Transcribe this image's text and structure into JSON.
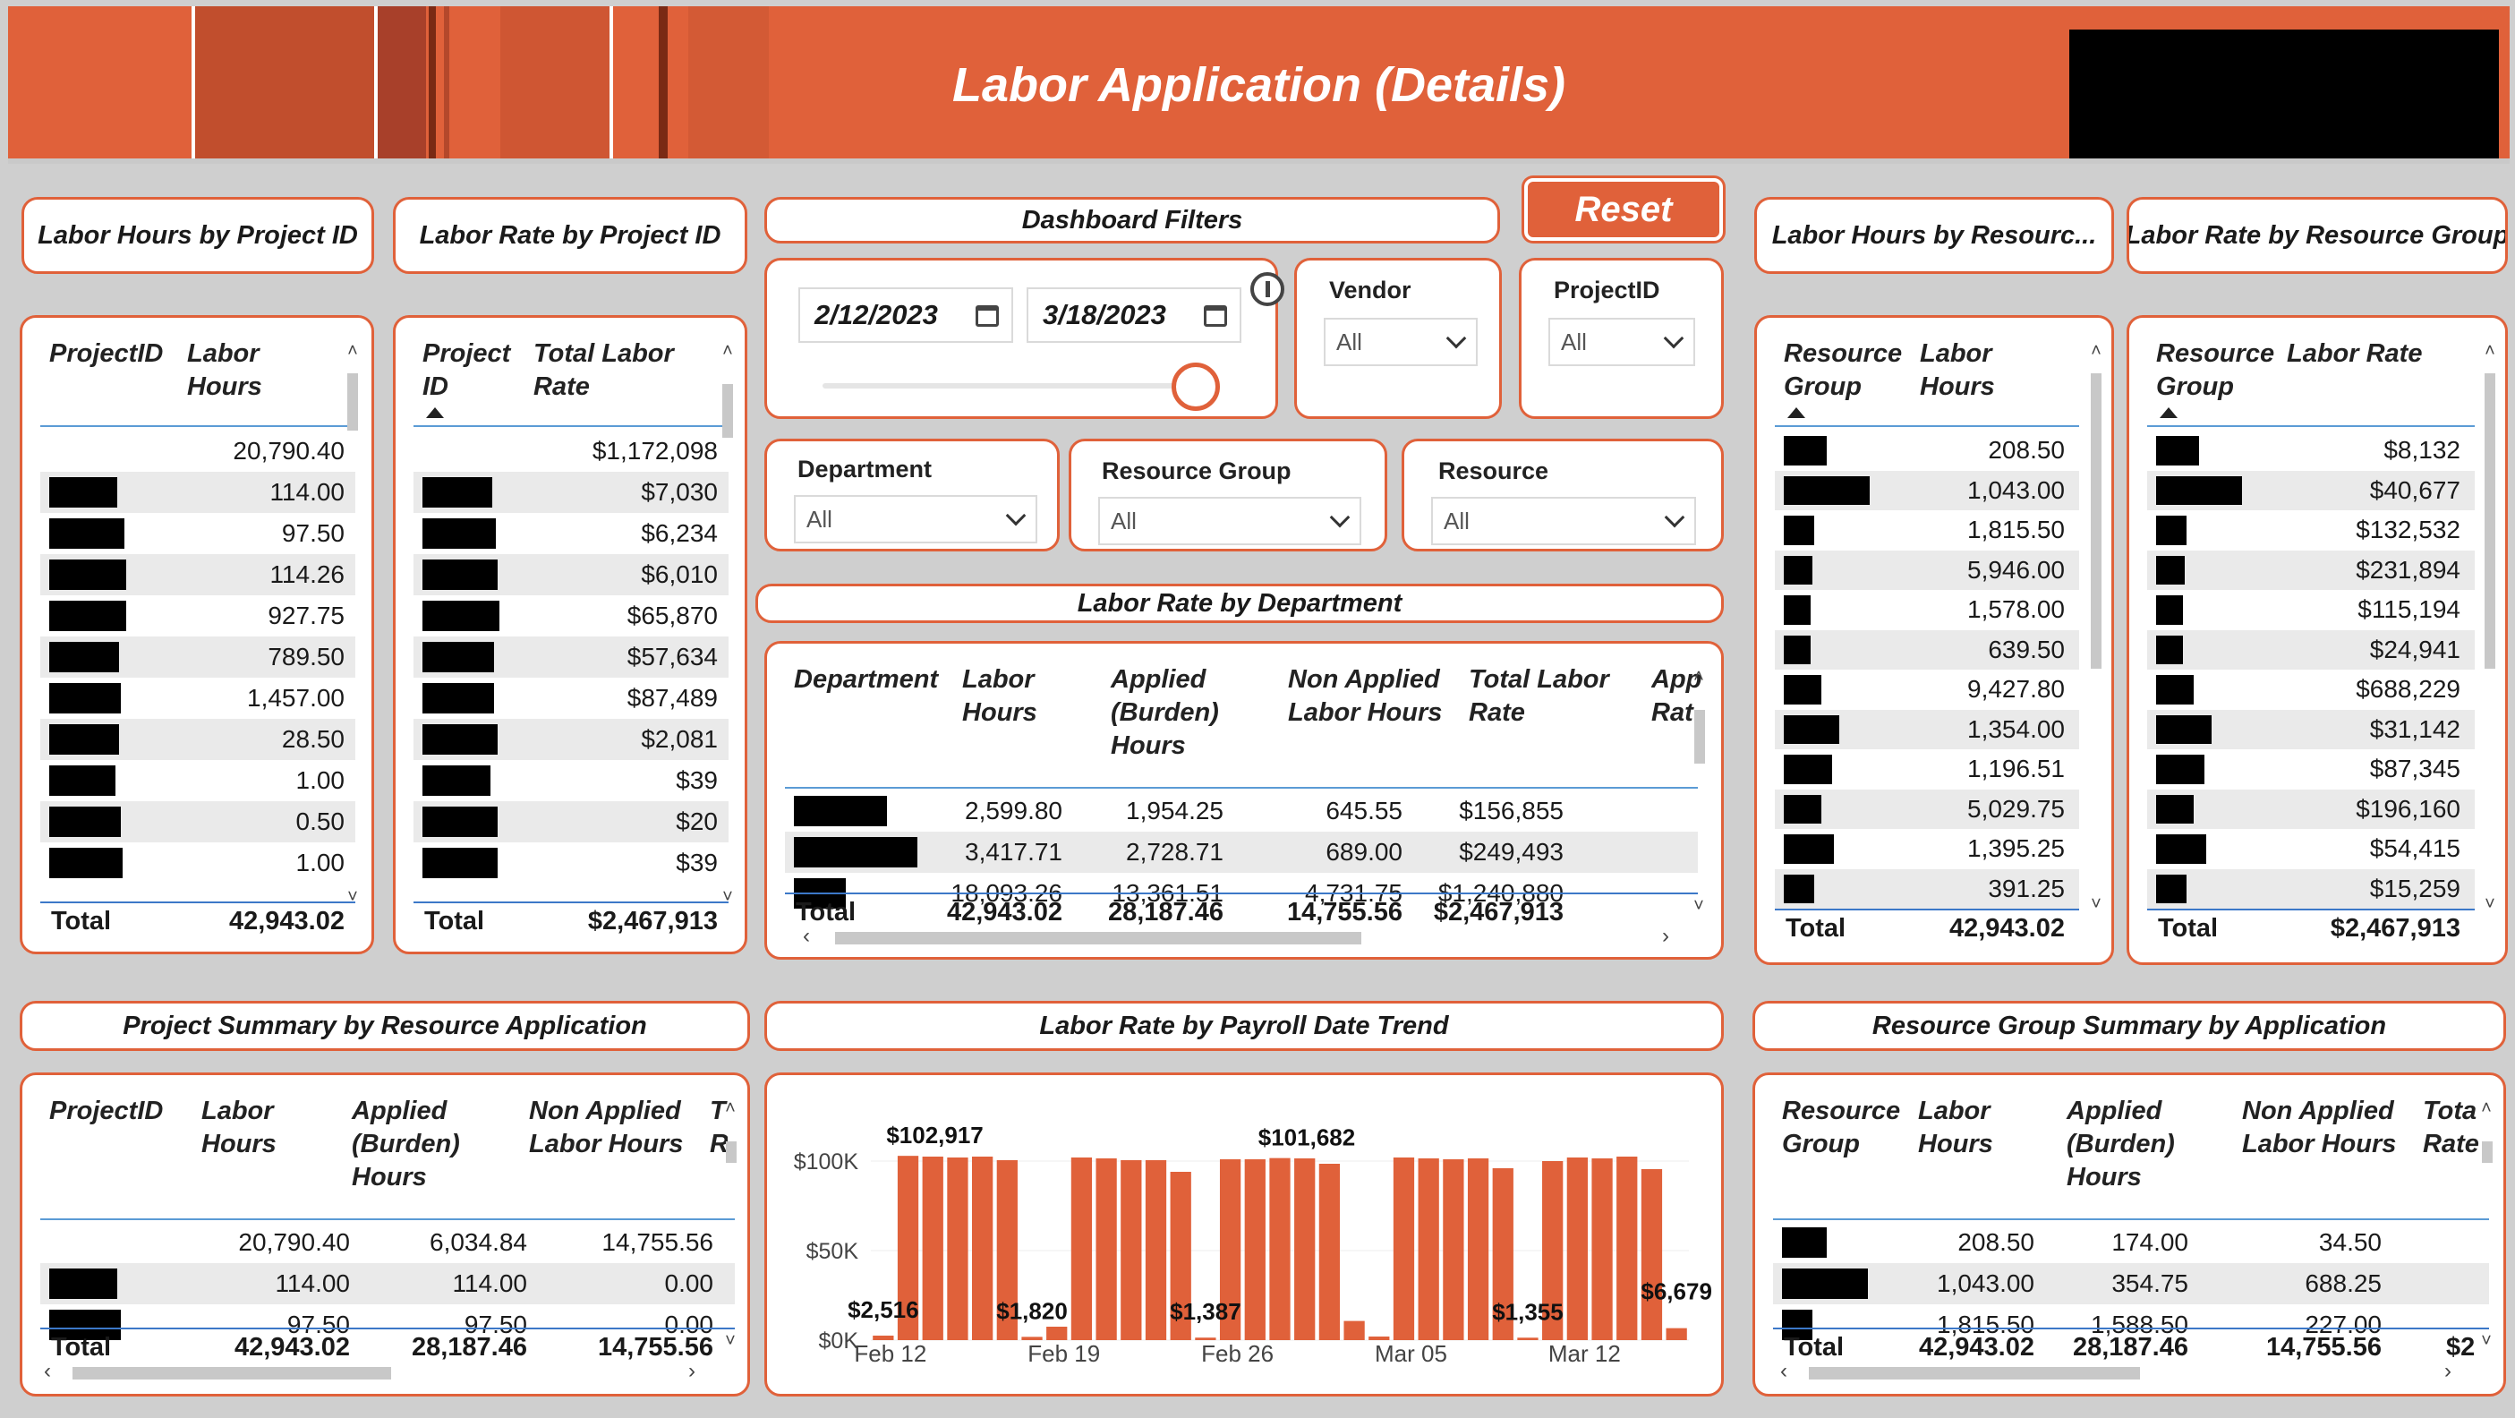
{
  "header": {
    "title": "Labor Application (Details)"
  },
  "titles": {
    "hours_by_project": "Labor Hours by Project ID",
    "rate_by_project": "Labor Rate by Project ID",
    "dashboard_filters": "Dashboard Filters",
    "hours_by_resource": "Labor Hours by Resourc...",
    "rate_by_resource": "Labor Rate by Resource Group",
    "rate_by_department": "Labor Rate by Department",
    "project_summary": "Project Summary by Resource Application",
    "payroll_trend": "Labor Rate by Payroll Date Trend",
    "resource_summary": "Resource Group Summary by Application"
  },
  "filters": {
    "reset_label": "Reset",
    "date_start": "2/12/2023",
    "date_end": "3/18/2023",
    "vendor": {
      "label": "Vendor",
      "value": "All"
    },
    "project": {
      "label": "ProjectID",
      "value": "All"
    },
    "department": {
      "label": "Department",
      "value": "All"
    },
    "resource_group": {
      "label": "Resource Group",
      "value": "All"
    },
    "resource": {
      "label": "Resource",
      "value": "All"
    }
  },
  "hours_by_project": {
    "headers": [
      "ProjectID",
      "Labor Hours"
    ],
    "rows": [
      "20,790.40",
      "114.00",
      "97.50",
      "114.26",
      "927.75",
      "789.50",
      "1,457.00",
      "28.50",
      "1.00",
      "0.50",
      "1.00"
    ],
    "total_label": "Total",
    "total": "42,943.02"
  },
  "rate_by_project": {
    "headers": [
      "Project ID",
      "Total Labor Rate"
    ],
    "rows": [
      "$1,172,098",
      "$7,030",
      "$6,234",
      "$6,010",
      "$65,870",
      "$57,634",
      "$87,489",
      "$2,081",
      "$39",
      "$20",
      "$39"
    ],
    "total_label": "Total",
    "total": "$2,467,913"
  },
  "hours_by_resource": {
    "headers": [
      "Resource Group",
      "Labor Hours"
    ],
    "rows": [
      "208.50",
      "1,043.00",
      "1,815.50",
      "5,946.00",
      "1,578.00",
      "639.50",
      "9,427.80",
      "1,354.00",
      "1,196.51",
      "5,029.75",
      "1,395.25",
      "391.25"
    ],
    "total_label": "Total",
    "total": "42,943.02"
  },
  "rate_by_resource": {
    "headers": [
      "Resource Group",
      "Labor Rate"
    ],
    "rows": [
      "$8,132",
      "$40,677",
      "$132,532",
      "$231,894",
      "$115,194",
      "$24,941",
      "$688,229",
      "$31,142",
      "$87,345",
      "$196,160",
      "$54,415",
      "$15,259"
    ],
    "total_label": "Total",
    "total": "$2,467,913"
  },
  "rate_by_department": {
    "headers": [
      "Department",
      "Labor Hours",
      "Applied (Burden) Hours",
      "Non Applied Labor Hours",
      "Total Labor Rate",
      "App Rat"
    ],
    "rows": [
      [
        "2,599.80",
        "1,954.25",
        "645.55",
        "$156,855"
      ],
      [
        "3,417.71",
        "2,728.71",
        "689.00",
        "$249,493"
      ],
      [
        "18,093.26",
        "13,361.51",
        "4,731.75",
        "$1,240,880"
      ]
    ],
    "total_label": "Total",
    "total": [
      "42,943.02",
      "28,187.46",
      "14,755.56",
      "$2,467,913"
    ]
  },
  "project_summary": {
    "headers": [
      "ProjectID",
      "Labor Hours",
      "Applied (Burden) Hours",
      "Non Applied Labor Hours",
      "T R"
    ],
    "rows": [
      [
        "20,790.40",
        "6,034.84",
        "14,755.56"
      ],
      [
        "114.00",
        "114.00",
        "0.00"
      ],
      [
        "97.50",
        "97.50",
        "0.00"
      ]
    ],
    "total_label": "Total",
    "total": [
      "42,943.02",
      "28,187.46",
      "14,755.56"
    ]
  },
  "resource_summary": {
    "headers": [
      "Resource Group",
      "Labor Hours",
      "Applied (Burden) Hours",
      "Non Applied Labor Hours",
      "Tota Rate"
    ],
    "rows": [
      [
        "208.50",
        "174.00",
        "34.50"
      ],
      [
        "1,043.00",
        "354.75",
        "688.25"
      ],
      [
        "1,815.50",
        "1,588.50",
        "227.00"
      ]
    ],
    "total_label": "Total",
    "total": [
      "42,943.02",
      "28,187.46",
      "14,755.56",
      "$2"
    ]
  },
  "chart_data": {
    "type": "bar",
    "title": "Labor Rate by Payroll Date Trend",
    "y_ticks": [
      "$100K",
      "$50K",
      "$0K"
    ],
    "x_ticks": [
      "Feb 12",
      "Feb 19",
      "Feb 26",
      "Mar 05",
      "Mar 12"
    ],
    "ylim": [
      0,
      118000
    ],
    "values": [
      2516,
      102917,
      102500,
      102000,
      102500,
      100500,
      1820,
      7500,
      102000,
      101500,
      100500,
      100500,
      94000,
      1387,
      101000,
      101000,
      101682,
      101500,
      98500,
      10700,
      2000,
      102000,
      101500,
      101000,
      101500,
      96000,
      1355,
      100000,
      102000,
      101500,
      102500,
      95500,
      6679
    ],
    "data_labels": [
      "$2,516",
      "$102,917",
      "$1,820",
      "$1,387",
      "$101,682",
      "$1,355",
      "$6,679"
    ],
    "bar_color": "#e0613a"
  }
}
